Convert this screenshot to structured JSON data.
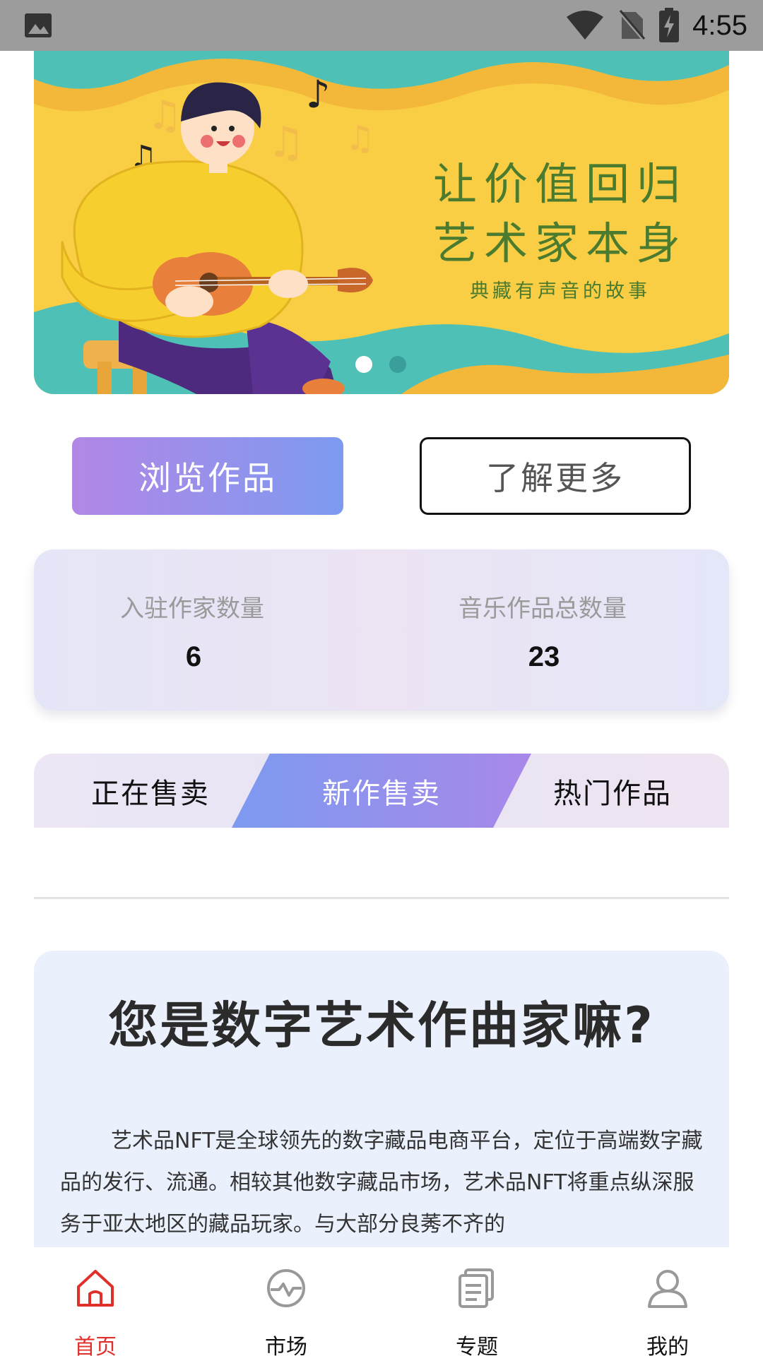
{
  "status_bar": {
    "time": "4:55"
  },
  "banner": {
    "headline_line1": "让价值回归",
    "headline_line2": "艺术家本身",
    "subtitle": "典藏有声音的故事"
  },
  "actions": {
    "browse_label": "浏览作品",
    "learn_more_label": "了解更多"
  },
  "stats": {
    "artists_label": "入驻作家数量",
    "artists_value": "6",
    "works_label": "音乐作品总数量",
    "works_value": "23"
  },
  "tabs": [
    {
      "label": "正在售卖"
    },
    {
      "label": "新作售卖"
    },
    {
      "label": "热门作品"
    }
  ],
  "info": {
    "title": "您是数字艺术作曲家嘛?",
    "body": "艺术品NFT是全球领先的数字藏品电商平台，定位于高端数字藏品的发行、流通。相较其他数字藏品市场，艺术品NFT将重点纵深服务于亚太地区的藏品玩家。与大部分良莠不齐的"
  },
  "bottom_nav": [
    {
      "label": "首页",
      "icon": "home-icon"
    },
    {
      "label": "市场",
      "icon": "market-icon"
    },
    {
      "label": "专题",
      "icon": "topics-icon"
    },
    {
      "label": "我的",
      "icon": "profile-icon"
    }
  ],
  "colors": {
    "accent_red": "#e0302c",
    "gradient_purple": "#b287e6",
    "gradient_blue": "#7d9af0",
    "banner_yellow": "#f9ce45"
  }
}
